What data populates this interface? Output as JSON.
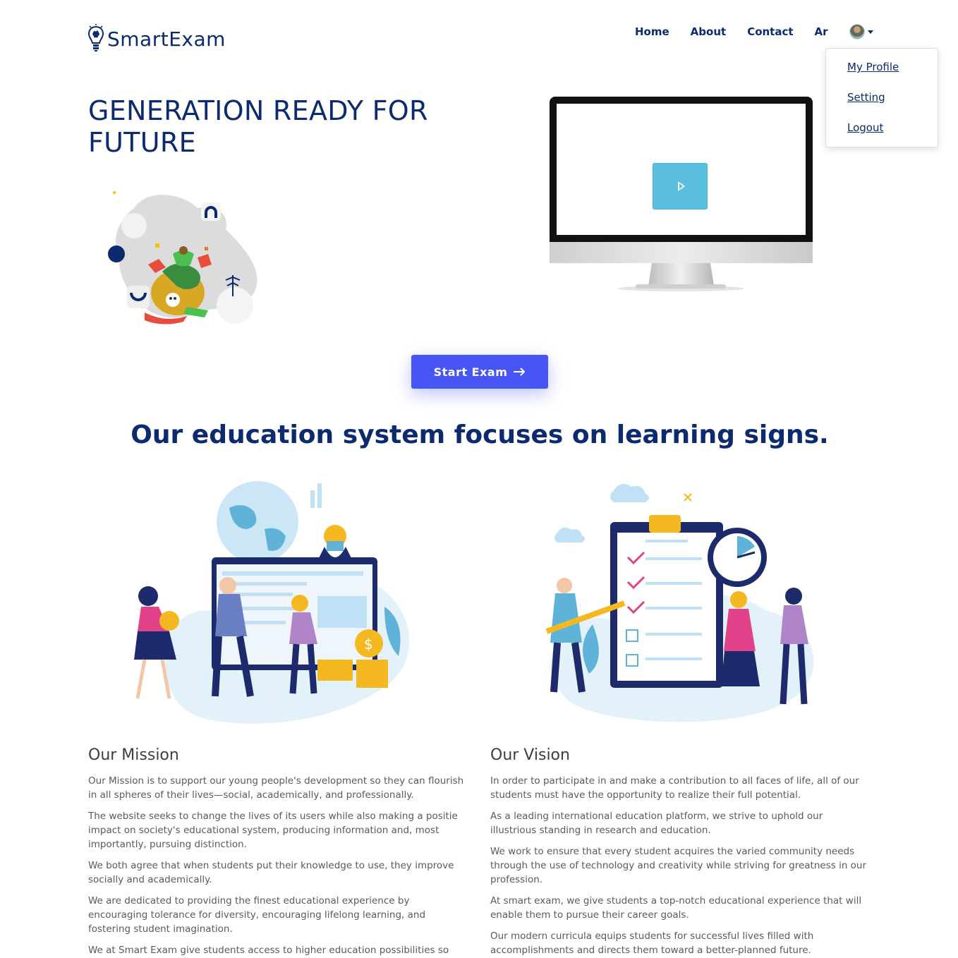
{
  "brand": {
    "name": "SmartExam"
  },
  "nav": {
    "items": [
      {
        "label": "Home"
      },
      {
        "label": "About"
      },
      {
        "label": "Contact"
      },
      {
        "label": "Ar"
      }
    ]
  },
  "user_menu": {
    "items": [
      {
        "label": "My Profile"
      },
      {
        "label": "Setting"
      },
      {
        "label": "Logout"
      }
    ]
  },
  "hero": {
    "title": "GENERATION READY FOR FUTURE",
    "cta_label": "Start Exam"
  },
  "section": {
    "title": "Our education system focuses on learning signs."
  },
  "mission": {
    "heading": "Our Mission",
    "paragraphs": [
      "Our Mission is to support our young people's development so they can flourish in all spheres of their lives—social, academically, and professionally.",
      "The website seeks to change the lives of its users while also making a positie impact on society's educational system, producing information and, most importantly, pursuing distinction.",
      "We both agree that when students put their knowledge to use, they improve socially and academically.",
      "We are dedicated to providing the finest educational experience by encouraging tolerance for diversity, encouraging lifelong learning, and fostering student imagination.",
      "We at Smart Exam give students access to higher education possibilities so they"
    ]
  },
  "vision": {
    "heading": "Our Vision",
    "paragraphs": [
      "In order to participate in and make a contribution to all faces of life, all of our students must have the opportunity to realize their full potential.",
      "As a leading international education platform, we strive to uphold our illustrious standing in research and education.",
      "We work to ensure that every student acquires the varied community needs through the use of technology and creativity while striving for greatness in our profession.",
      "At smart exam, we give students a top-notch educational experience that will enable them to pursue their career goals.",
      "Our modern curricula equips students for successful lives filled with accomplishments and directs them toward a better-planned future."
    ]
  },
  "icons": {
    "logo": "lightbulb-brain-icon",
    "play": "play-icon",
    "arrow": "arrow-right-icon",
    "caret": "caret-down-icon"
  },
  "colors": {
    "brand": "#0b2a6f",
    "cta": "#4855f5",
    "play": "#5bc0de"
  }
}
